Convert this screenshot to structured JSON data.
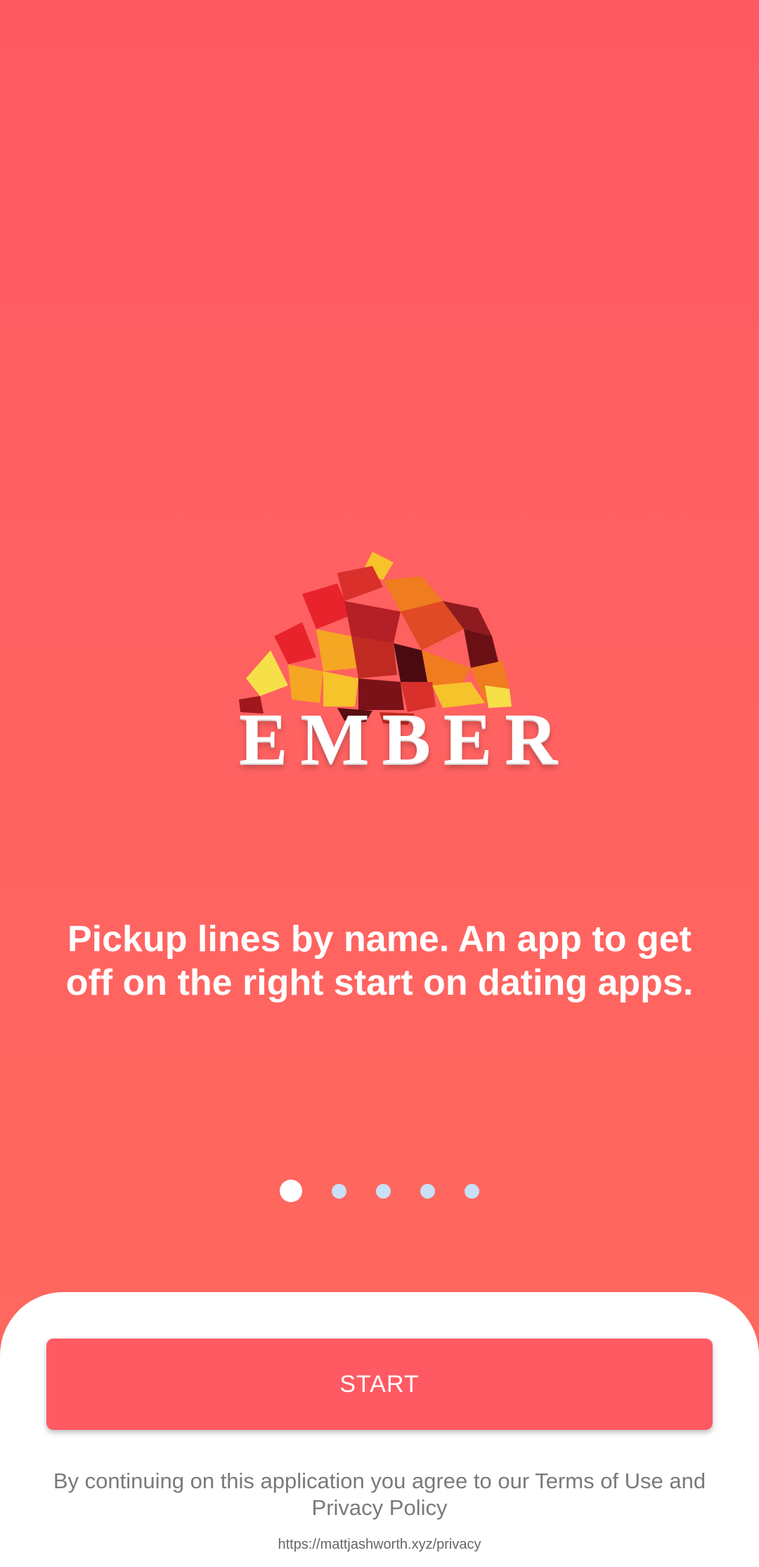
{
  "app": {
    "brand_name": "EMBER",
    "accent_color": "#ff5a64"
  },
  "onboarding": {
    "tagline": "Pickup lines by name. An app to get off on the right start on dating apps.",
    "page_indicator": {
      "total_pages": 5,
      "current_page": 1
    }
  },
  "footer": {
    "start_label": "START",
    "consent_text": "By continuing on this application you agree to our Terms of Use and Privacy Policy",
    "privacy_url": "https://mattjashworth.xyz/privacy"
  }
}
